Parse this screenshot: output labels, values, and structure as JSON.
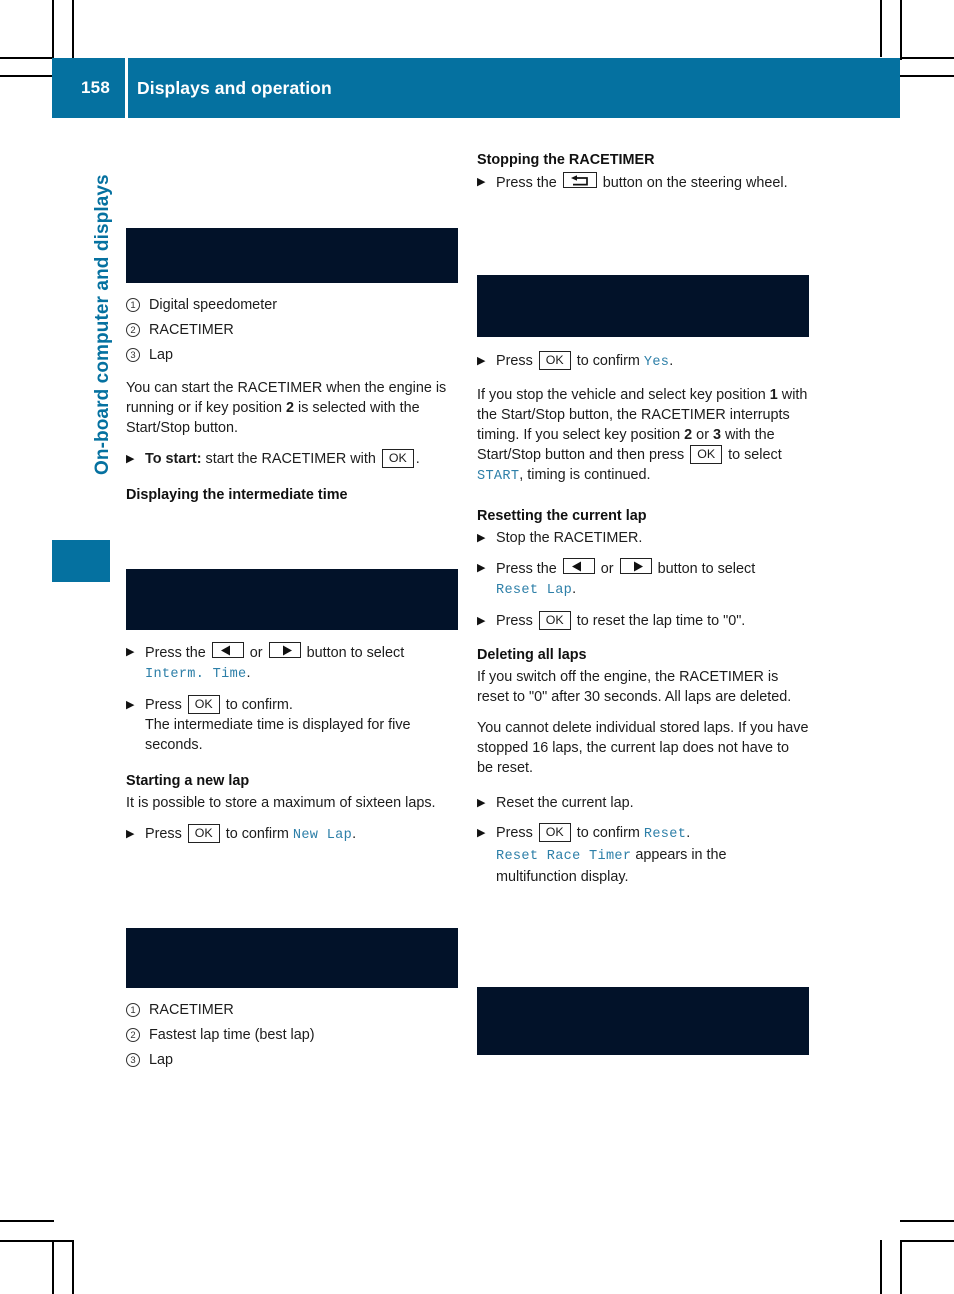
{
  "page": {
    "number": "158",
    "header_title": "Displays and operation",
    "chapter_tab": "On-board computer and displays",
    "accent_color": "#0571A0",
    "figure_color": "#021229",
    "mfd_text_color": "#2D7FA8"
  },
  "left_column": {
    "figure_1_alt": "RACETIMER multifunction display showing digital speedometer, racetimer and lap",
    "legend_1": [
      {
        "num": "1",
        "label": "Digital speedometer"
      },
      {
        "num": "2",
        "label": "RACETIMER"
      },
      {
        "num": "3",
        "label": "Lap"
      }
    ],
    "intro_para": {
      "part1": "You can start the RACETIMER when the engine is running or if key position ",
      "key_position": "2",
      "part2": " is selected with the Start/Stop button."
    },
    "start_step": {
      "lead_bold": "To start:",
      "text_before": " start the RACETIMER with ",
      "key": "OK",
      "text_after": "."
    },
    "heading_intermediate": "Displaying the intermediate time",
    "figure_2_alt": "Multifunction display showing Interm. Time selection",
    "intermediate_steps": [
      {
        "before": "Press the ",
        "key_left": "left-arrow",
        "middle": " or ",
        "key_right": "right-arrow",
        "after": " button to select ",
        "mfd": "Interm. Time",
        "tail": "."
      },
      {
        "before": "Press ",
        "key": "OK",
        "after": " to confirm.",
        "subline": "The intermediate time is displayed for five seconds."
      }
    ],
    "heading_new_lap": "Starting a new lap",
    "new_lap_para": "It is possible to store a maximum of sixteen laps.",
    "new_lap_step": {
      "before": "Press ",
      "key": "OK",
      "middle": " to confirm ",
      "mfd": "New Lap",
      "after": "."
    },
    "figure_3_alt": "Multifunction display showing RACETIMER, fastest lap time and lap",
    "legend_2": [
      {
        "num": "1",
        "label": "RACETIMER"
      },
      {
        "num": "2",
        "label": "Fastest lap time (best lap)"
      },
      {
        "num": "3",
        "label": "Lap"
      }
    ]
  },
  "right_column": {
    "heading_stopping": "Stopping the RACETIMER",
    "stopping_step": {
      "before": "Press the ",
      "key_icon": "back-arrow",
      "after": " button on the steering wheel."
    },
    "figure_4_alt": "Multifunction display prompting to stop the RACETIMER",
    "confirm_step": {
      "before": "Press ",
      "key": "OK",
      "middle": " to confirm ",
      "mfd": "Yes",
      "after": "."
    },
    "stop_para": {
      "p1": "If you stop the vehicle and select key position ",
      "b1": "1",
      "p2": " with the Start/Stop button, the RACETIMER interrupts timing. If you select key position ",
      "b2": "2",
      "p3": " or ",
      "b3": "3",
      "p4": " with the Start/Stop button and then press ",
      "key": "OK",
      "p5": " to select ",
      "mfd": "START",
      "p6": ", timing is continued."
    },
    "heading_resetting": "Resetting the current lap",
    "reset_steps": [
      {
        "text": "Stop the RACETIMER."
      },
      {
        "before": "Press the ",
        "key_left": "left-arrow",
        "middle": " or ",
        "key_right": "right-arrow",
        "after": " button to select ",
        "mfd": "Reset Lap",
        "tail": "."
      },
      {
        "before": "Press ",
        "key": "OK",
        "after": " to reset the lap time to \"0\"."
      }
    ],
    "heading_deleting": "Deleting all laps",
    "delete_para_1": "If you switch off the engine, the RACETIMER is reset to \"0\" after 30 seconds. All laps are deleted.",
    "delete_para_2": "You cannot delete individual stored laps. If you have stopped 16 laps, the current lap does not have to be reset.",
    "delete_steps": [
      {
        "text": "Reset the current lap."
      },
      {
        "before": "Press ",
        "key": "OK",
        "middle": " to confirm ",
        "mfd": "Reset",
        "after": ".",
        "subline_mfd": "Reset Race Timer",
        "subline_rest": " appears in the multifunction display."
      }
    ],
    "figure_5_alt": "Multifunction display showing Reset Race Timer message"
  }
}
